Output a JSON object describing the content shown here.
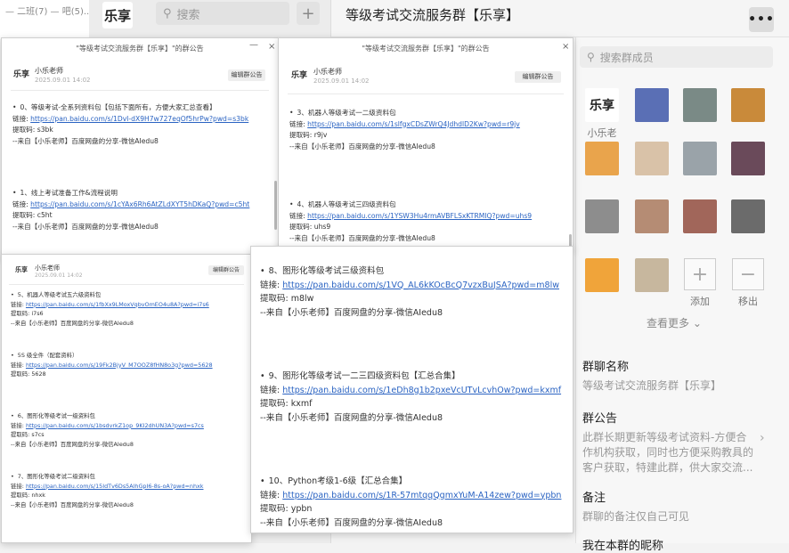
{
  "app": {
    "top_strip_text": "— 二班(7) — 吧(5)...",
    "logo_text": "乐享",
    "search_placeholder": "搜索",
    "add_symbol": "+",
    "chat_title": "等级考试交流服务群【乐享】",
    "more_symbol": "•••"
  },
  "right_panel": {
    "member_search_placeholder": "搜索群成员",
    "members": [
      {
        "name": "小乐老师",
        "color": "#ffffff"
      },
      {
        "name": "",
        "color": "#5a6fb5"
      },
      {
        "name": "",
        "color": "#7a8a86"
      },
      {
        "name": "",
        "color": "#c98a3a"
      },
      {
        "name": "",
        "color": "#e9a44c"
      },
      {
        "name": "",
        "color": "#d9c2a8"
      },
      {
        "name": "",
        "color": "#9aa3a9"
      },
      {
        "name": "",
        "color": "#6a4a5a"
      },
      {
        "name": "",
        "color": "#8d8d8d"
      },
      {
        "name": "",
        "color": "#b58c74"
      },
      {
        "name": "",
        "color": "#a1665a"
      },
      {
        "name": "",
        "color": "#6b6b6b"
      },
      {
        "name": "",
        "color": "#f0a43a"
      },
      {
        "name": "",
        "color": "#c7b79e"
      }
    ],
    "add_label": "添加",
    "remove_label": "移出",
    "see_more": "查看更多",
    "group_name_label": "群聊名称",
    "group_name_value": "等级考试交流服务群【乐享】",
    "announcement_label": "群公告",
    "announcement_value": "此群长期更新等级考试资料-方便合作机构获取，同时也方便采购教具的客户获取，特建此群，供大家交流...",
    "remark_label": "备注",
    "remark_value": "群聊的备注仅自己可见",
    "bottom_cut_label": "我在本群的昵称"
  },
  "popups": {
    "common": {
      "title": "\"等级考试交流服务群【乐享】\"的群公告",
      "logo": "乐享",
      "author": "小乐老师",
      "date": "2025.09.01 14:02",
      "edit_button": "编辑群公告",
      "close": "×",
      "minimize": "—"
    },
    "p1_entries": [
      {
        "title": "0、等级考试-全系列资料包【包括下面所有，方便大家汇总查看】",
        "link": "https://pan.baidu.com/s/1DvI-dX9H7w727eqOf5hrPw?pwd=s3bk",
        "code": "s3bk",
        "source": "--来自【小乐老师】百度网盘的分享-微信AIedu8"
      },
      {
        "title": "1、线上考试准备工作&流程说明",
        "link": "https://pan.baidu.com/s/1cYAx6Rh6AtZLdXYT5hDKaQ?pwd=c5ht",
        "code": "c5ht",
        "source": "--来自【小乐老师】百度网盘的分享-微信AIedu8"
      }
    ],
    "p2_entries": [
      {
        "title": "3、机器人等级考试一二级资料包",
        "link": "https://pan.baidu.com/s/1slfgxCDsZWrQ4JdhdlD2Kw?pwd=r9jv",
        "code": "r9jv",
        "source": "--来自【小乐老师】百度网盘的分享-微信AIedu8"
      },
      {
        "title": "4、机器人等级考试三四级资料包",
        "link": "https://pan.baidu.com/s/1YSW3Hu4rmAVBFLSxKTRMIQ?pwd=uhs9",
        "code": "uhs9",
        "source": "--来自【小乐老师】百度网盘的分享-微信AIedu8"
      }
    ],
    "p3_entries": [
      {
        "title": "5、机器人等级考试五六级资料包",
        "link": "https://pan.baidu.com/s/1fbXx9LMoxVqbvOmEO4u8A?pwd=i7s6",
        "code": "i7s6",
        "source": "--来自【小乐老师】百度网盘的分享-微信AIedu8"
      },
      {
        "title": "5S 级全件（配套资料）",
        "link": "https://pan.baidu.com/s/19Fk2BjyV_M7OOZ8fHN8o3g?pwd=5628",
        "code": "5628",
        "source": ""
      },
      {
        "title": "6、图形化等级考试一级资料包",
        "link": "https://pan.baidu.com/s/1bsdvrkZ1op_9KI2dhUN3A?pwd=s7cs",
        "code": "s7cs",
        "source": "--来自【小乐老师】百度网盘的分享-微信AIedu8"
      },
      {
        "title": "7、图形化等级考试二级资料包",
        "link": "https://pan.baidu.com/s/15IdTv6Ds5AlhGpI6-8s-oA?pwd=nhxk",
        "code": "nhxk",
        "source": "--来自【小乐老师】百度网盘的分享-微信AIedu8"
      }
    ],
    "p4_entries": [
      {
        "title": "8、图形化等级考试三级资料包",
        "link": "https://pan.baidu.com/s/1VQ_AL6kKOcBcQ7vzxBuJSA?pwd=m8lw",
        "code": "m8lw",
        "source": "--来自【小乐老师】百度网盘的分享-微信AIedu8"
      },
      {
        "title": "9、图形化等级考试一二三四级资料包【汇总合集】",
        "link": "https://pan.baidu.com/s/1eDh8g1b2pxeVcUTvLcvhOw?pwd=kxmf",
        "code": "kxmf",
        "source": "--来自【小乐老师】百度网盘的分享-微信AIedu8"
      },
      {
        "title": "10、Python考级1-6级【汇总合集】",
        "link": "https://pan.baidu.com/s/1R-57mtqqQgmxYuM-A14zew?pwd=ypbn",
        "code": "ypbn",
        "source": "--来自【小乐老师】百度网盘的分享-微信AIedu8"
      }
    ],
    "labels": {
      "link": "链接: ",
      "code": "提取码: "
    }
  }
}
